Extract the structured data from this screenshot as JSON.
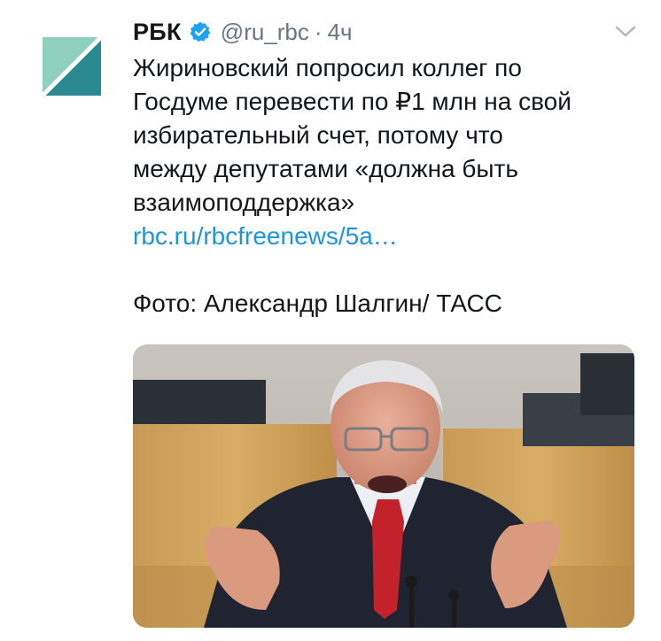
{
  "account": {
    "name": "РБК",
    "handle": "@ru_rbc",
    "separator": "·",
    "time": "4ч",
    "verified_icon": "verified-badge-icon",
    "avatar_colors": {
      "light": "#8fd0bd",
      "dark": "#2a8a8f"
    }
  },
  "tweet": {
    "lines": [
      "Жириновский попросил коллег по",
      "Госдуме перевести по ₽1 млн на свой",
      "избирательный счет, потому что",
      "между депутатами «должна быть",
      "взаимоподдержка»"
    ],
    "link": "rbc.ru/rbcfreenews/5a…",
    "credit": "Фото: Александр Шалгин/ ТАСС"
  },
  "colors": {
    "text": "#14171a",
    "secondary": "#657786",
    "link": "#1b95e0",
    "verified": "#1da1f2"
  },
  "icons": {
    "caret": "chevron-down-icon"
  }
}
